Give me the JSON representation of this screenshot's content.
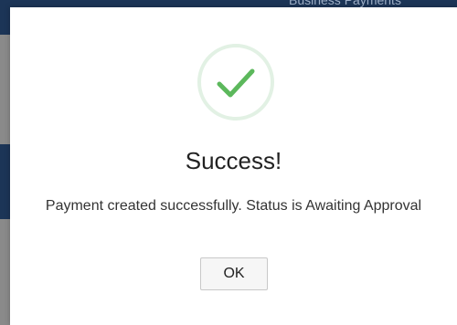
{
  "background": {
    "header_text": "Business Payments"
  },
  "dialog": {
    "icon": "checkmark-icon",
    "title": "Success!",
    "message": "Payment created successfully. Status is Awaiting Approval",
    "ok_label": "OK"
  },
  "colors": {
    "success_green": "#5cb85c",
    "icon_ring": "#e2f1e4",
    "nav_blue": "#1c3557"
  }
}
